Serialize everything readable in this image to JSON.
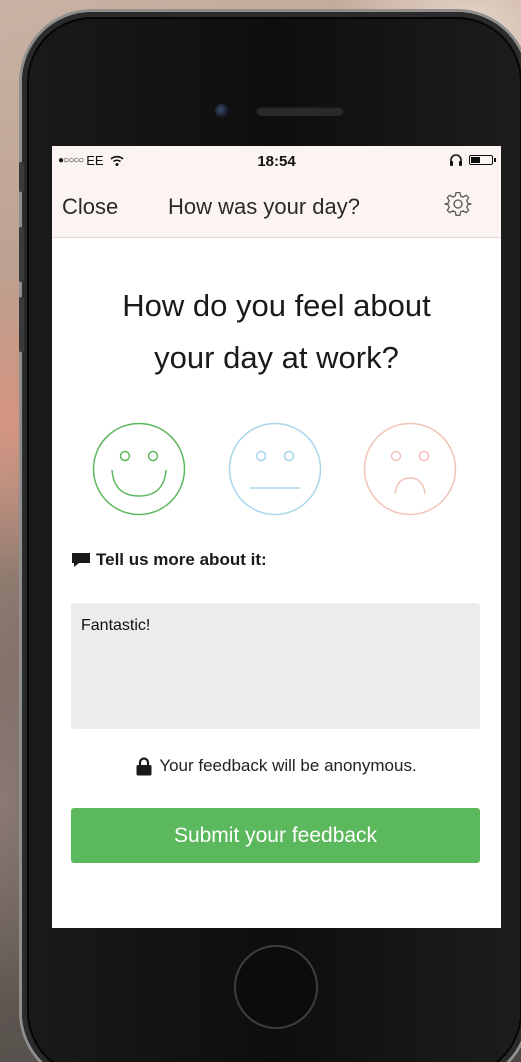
{
  "status_bar": {
    "signal": "●○○○○",
    "carrier": "EE",
    "time": "18:54"
  },
  "nav": {
    "close_label": "Close",
    "title": "How was your day?"
  },
  "main": {
    "question_line1": "How do you feel about",
    "question_line2": "your day at work?",
    "faces": [
      {
        "name": "happy",
        "color": "#5cb85c"
      },
      {
        "name": "neutral",
        "color": "#a9d6ea"
      },
      {
        "name": "sad",
        "color": "#f1c4b8"
      }
    ],
    "tell_more_label": "Tell us more about it:",
    "feedback_text": "Fantastic!",
    "anonymous_note": "Your feedback will be anonymous.",
    "submit_label": "Submit your feedback"
  },
  "colors": {
    "accent": "#5cb85c",
    "nav_background": "#fbf4f2",
    "field_background": "#ececec"
  }
}
